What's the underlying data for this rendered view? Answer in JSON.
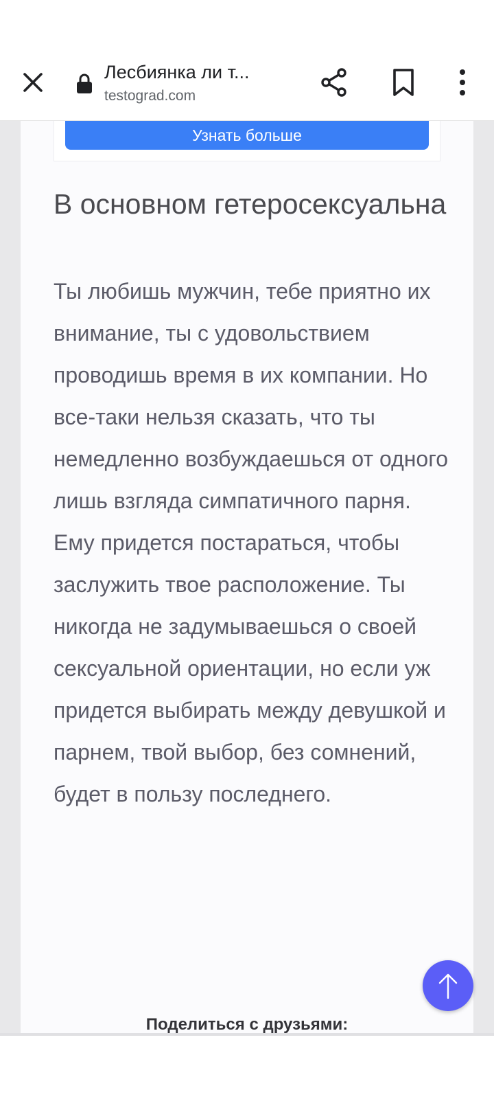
{
  "toolbar": {
    "page_title": "Лесбиянка ли т...",
    "domain": "testograd.com",
    "icons": {
      "close": "close-icon",
      "lock": "lock-icon",
      "share": "share-icon",
      "bookmark": "bookmark-icon",
      "menu": "more-vert-icon"
    }
  },
  "ad": {
    "button_label": "Узнать больше",
    "color": "#3a7ff6"
  },
  "result": {
    "title": "В основном гетеросексуальна",
    "body": "Ты любишь мужчин, тебе приятно их внимание, ты с удовольствием проводишь время в их компании. Но все-таки нельзя сказать, что ты немедленно возбуждаешься от одного лишь взгляда симпатичного парня. Ему придется постараться, чтобы заслужить твое расположение. Ты никогда не задумываешься о своей сексуальной ориентации, но если уж придется выбирать между девушкой и парнем, твой выбор, без сомнений, будет в пользу последнего."
  },
  "share": {
    "caption": "Поделиться с друзьями:"
  },
  "fab": {
    "icon": "arrow-up-icon",
    "color": "#5b5ef7"
  }
}
